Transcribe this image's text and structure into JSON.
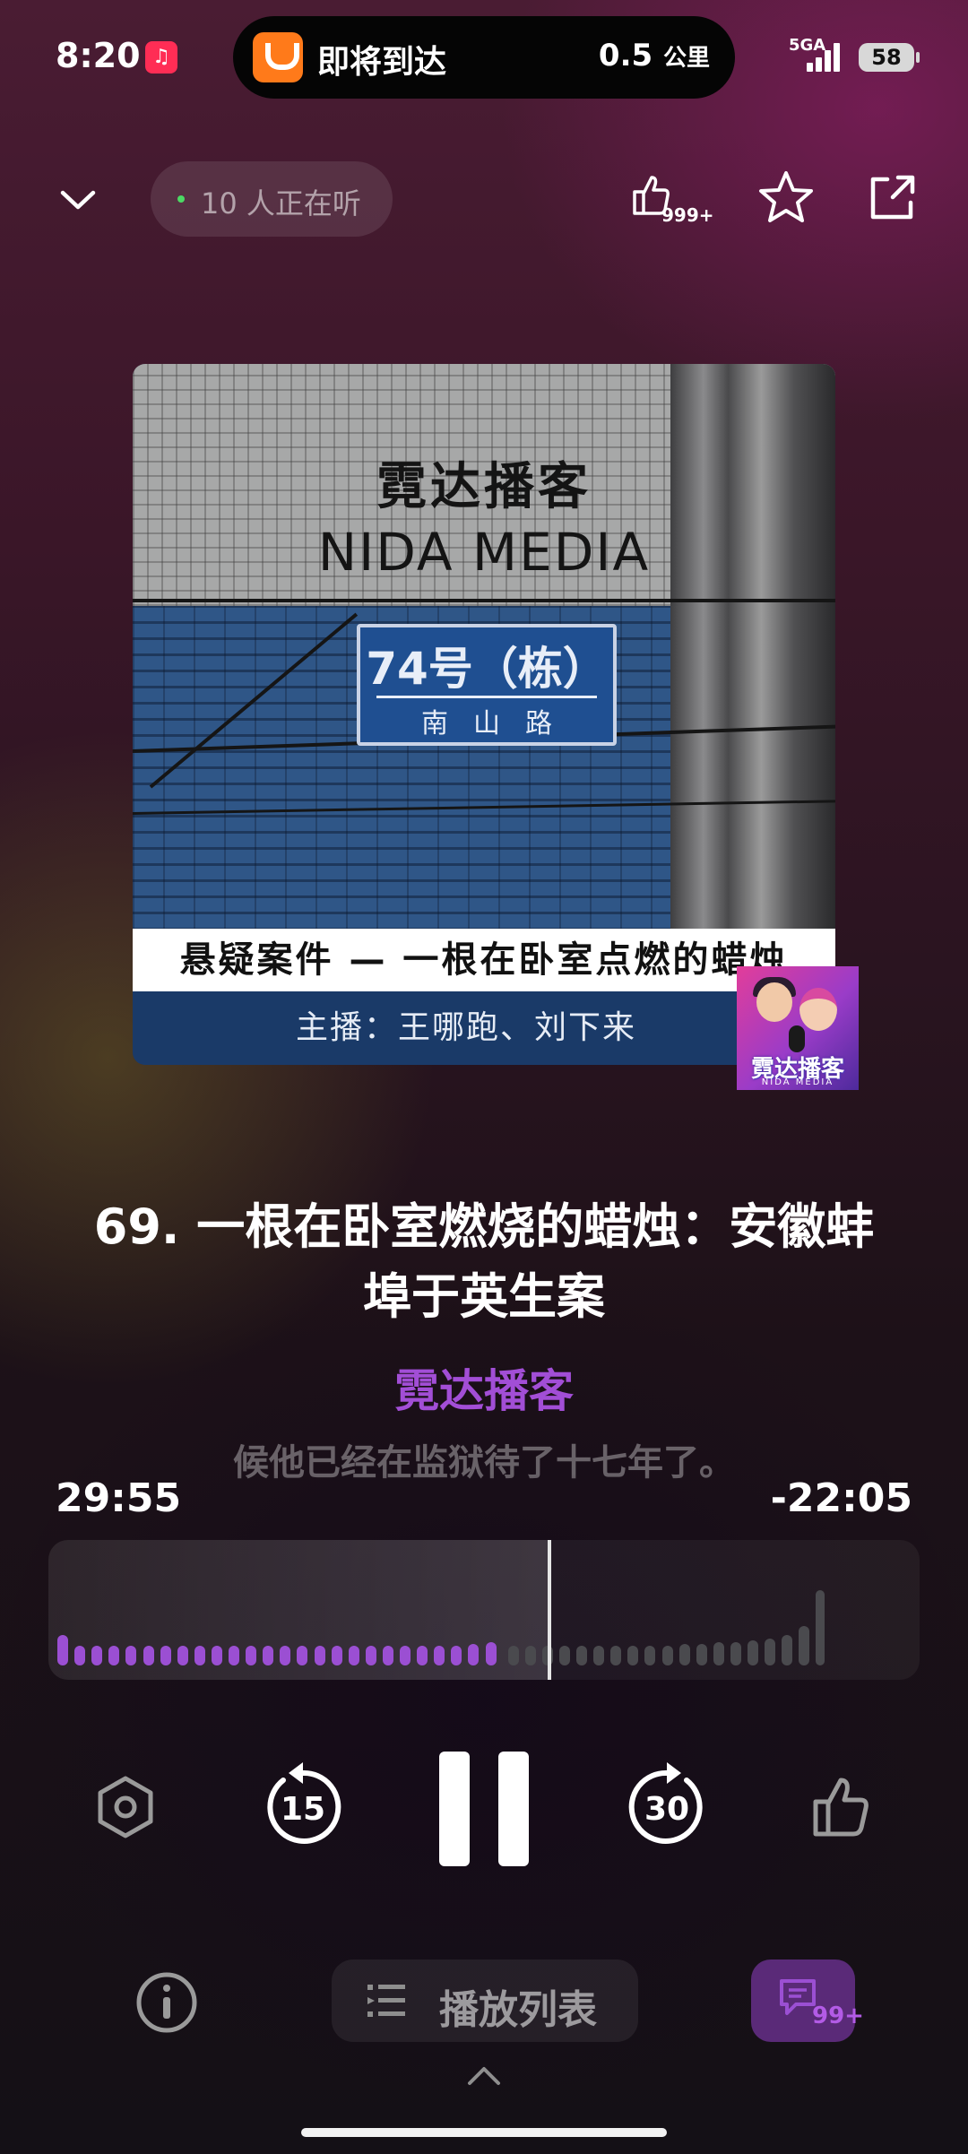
{
  "status_bar": {
    "time": "8:20",
    "music_icon": "music-note-icon",
    "didi_text": "即将到达",
    "didi_distance": "0.5",
    "didi_unit": "公里",
    "network": "5GA",
    "battery": "58"
  },
  "header": {
    "listeners": "10 人正在听",
    "like_count": "999+"
  },
  "artwork": {
    "title_cn": "霓达播客",
    "title_en": "NIDA MEDIA",
    "sign_number": "74号（栋）",
    "sign_road": "南山路",
    "caption": "悬疑案件 — 一根在卧室点燃的蜡烛",
    "hosts": "主播：王哪跑、刘下来",
    "badge_text": "霓达播客",
    "badge_sub": "NIDA MEDIA"
  },
  "episode": {
    "title": "69. 一根在卧室燃烧的蜡烛：安徽蚌埠于英生案",
    "author": "霓达播客",
    "lyric": "候他已经在监狱待了十七年了。"
  },
  "playback": {
    "elapsed": "29:55",
    "remaining": "-22:05",
    "progress": 0.575,
    "wave_played": [
      34,
      22,
      22,
      22,
      22,
      22,
      22,
      22,
      22,
      22,
      22,
      22,
      22,
      22,
      22,
      22,
      22,
      22,
      22,
      22,
      22,
      22,
      22,
      22,
      24,
      26
    ],
    "wave_rest": [
      22,
      22,
      22,
      22,
      22,
      22,
      22,
      22,
      22,
      22,
      24,
      24,
      26,
      26,
      28,
      30,
      34,
      44,
      84
    ]
  },
  "bottom": {
    "playlist_label": "播放列表",
    "comment_count": "99+"
  },
  "colors": {
    "accent": "#a24ed6",
    "wave_played": "#9b4fd3",
    "wave_rest": "#4a4a4e"
  }
}
